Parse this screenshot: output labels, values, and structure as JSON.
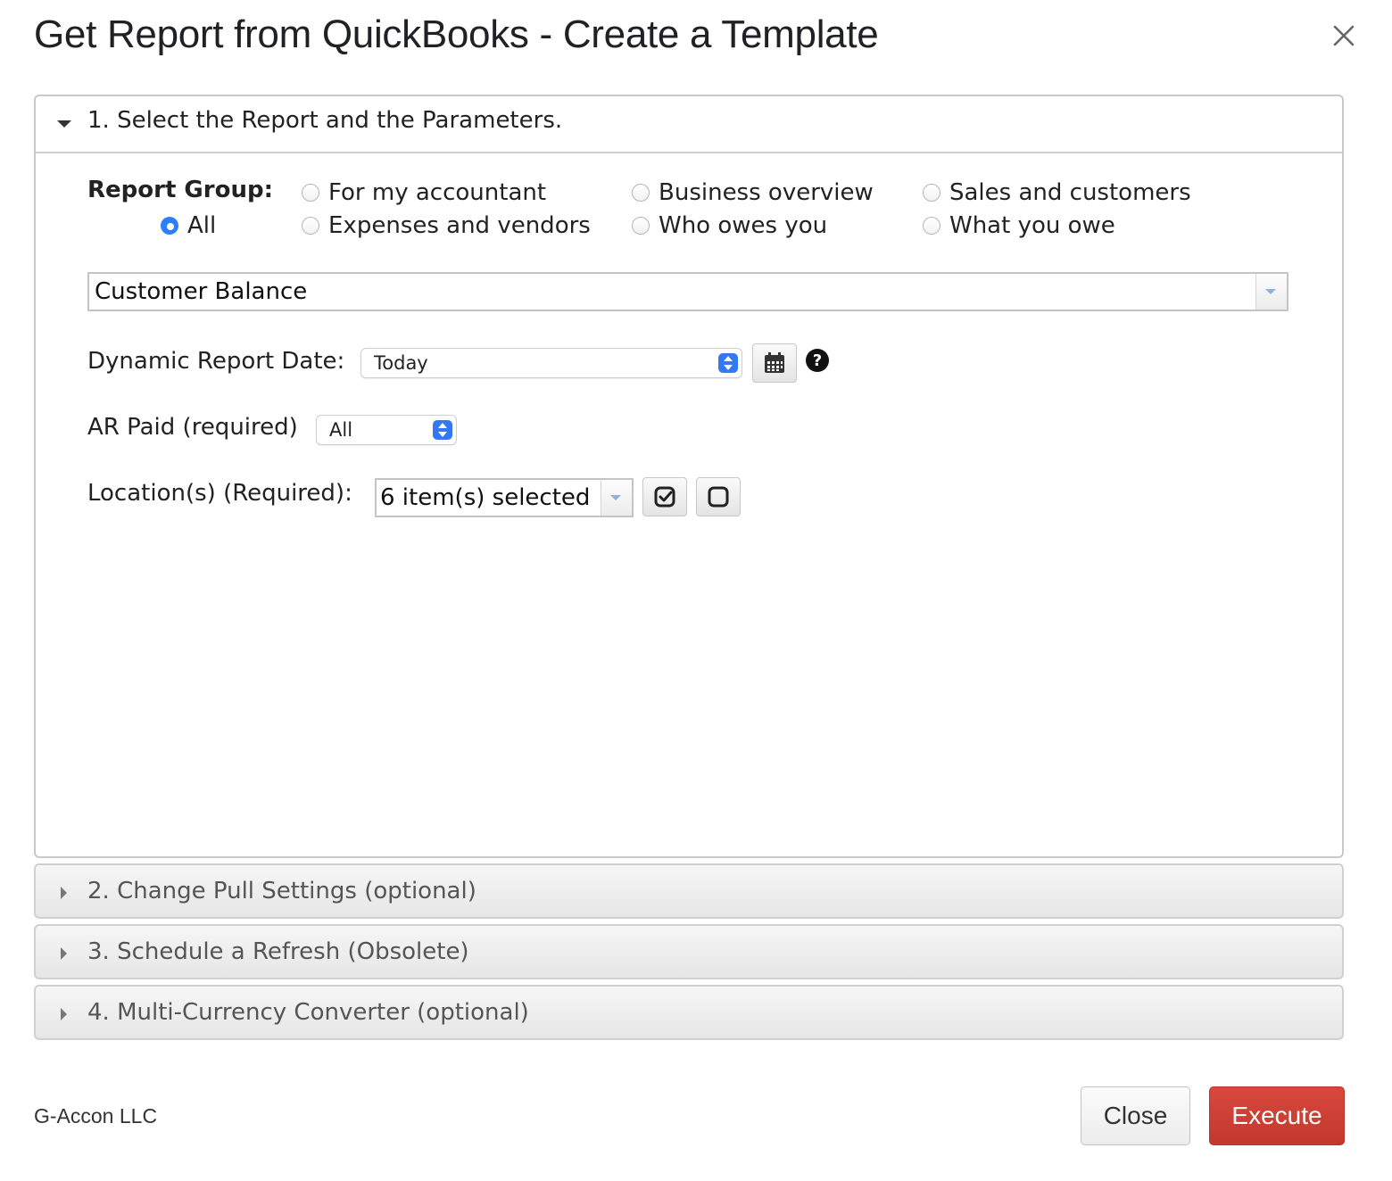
{
  "dialog": {
    "title": "Get Report from QuickBooks - Create a Template",
    "close_icon": "close-icon"
  },
  "section1": {
    "title": "1. Select the Report and the Parameters.",
    "expanded": true,
    "report_group": {
      "label": "Report Group:",
      "options": [
        {
          "label": "All",
          "selected": true
        },
        {
          "label": "For my accountant",
          "selected": false
        },
        {
          "label": "Expenses and vendors",
          "selected": false
        },
        {
          "label": "Business overview",
          "selected": false
        },
        {
          "label": "Who owes you",
          "selected": false
        },
        {
          "label": "Sales and customers",
          "selected": false
        },
        {
          "label": "What you owe",
          "selected": false
        }
      ]
    },
    "report_select": {
      "value": "Customer Balance"
    },
    "dynamic_date": {
      "label": "Dynamic Report Date:",
      "value": "Today"
    },
    "ar_paid": {
      "label": "AR Paid (required)",
      "value": "All"
    },
    "locations": {
      "label": "Location(s) (Required):",
      "value": "6 item(s) selected"
    }
  },
  "sections": [
    {
      "title": "2. Change Pull Settings (optional)",
      "expanded": false
    },
    {
      "title": "3. Schedule a Refresh (Obsolete)",
      "expanded": false
    },
    {
      "title": "4. Multi-Currency Converter (optional)",
      "expanded": false
    }
  ],
  "footer": {
    "company": "G-Accon LLC",
    "close_label": "Close",
    "execute_label": "Execute"
  },
  "colors": {
    "accent": "#2d7ff9",
    "execute": "#c9403a"
  }
}
